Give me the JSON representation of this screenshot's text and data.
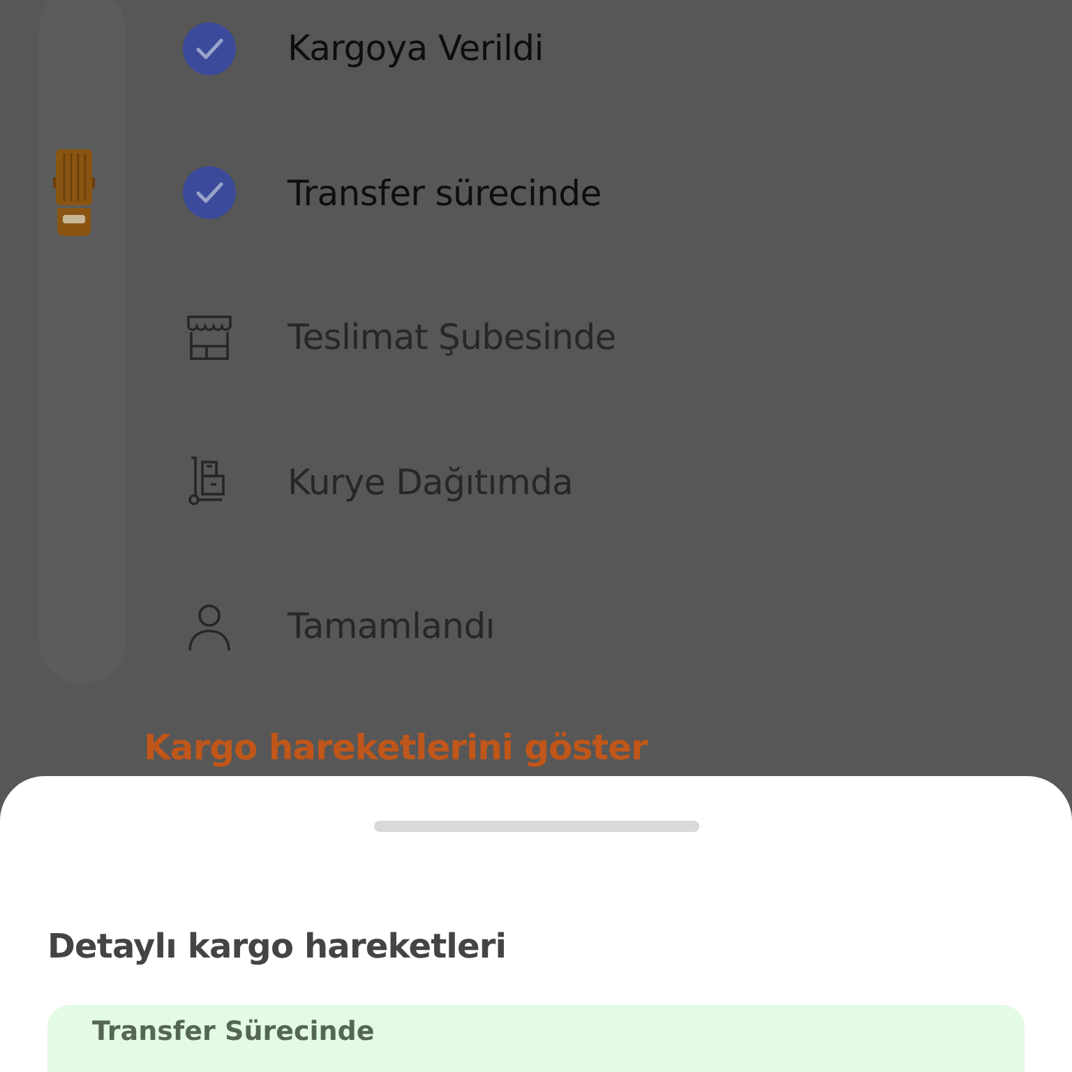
{
  "steps": [
    {
      "label": "Kargoya Verildi",
      "done": true,
      "current": false,
      "kind": "check"
    },
    {
      "label": "Transfer sürecinde",
      "done": true,
      "current": true,
      "kind": "check"
    },
    {
      "label": "Teslimat Şubesinde",
      "done": false,
      "current": false,
      "kind": "store"
    },
    {
      "label": "Kurye Dağıtımda",
      "done": false,
      "current": false,
      "kind": "dolly"
    },
    {
      "label": "Tamamlandı",
      "done": false,
      "current": false,
      "kind": "person"
    }
  ],
  "show_link": "Kargo hareketlerini göster",
  "sheet": {
    "title": "Detaylı kargo hareketleri",
    "events": [
      {
        "status": "Transfer Sürecinde"
      }
    ]
  }
}
